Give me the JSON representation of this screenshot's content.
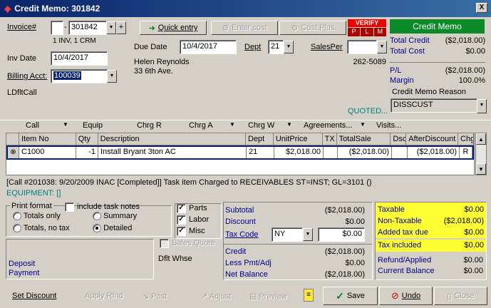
{
  "window": {
    "title": "Credit Memo: 301842",
    "close": "X"
  },
  "invoice": {
    "label": "Invoice#",
    "prefix": "",
    "number": "301842",
    "sub": "1 INV, 1 CRM"
  },
  "toolbar": {
    "quick_entry": "Quick entry",
    "enter_cost": "Enter cost",
    "cost_plus": "Cost Plus"
  },
  "verify": {
    "label": "VERIFY",
    "p": "P",
    "l": "L",
    "m": "M"
  },
  "memo_header": {
    "label": "Credit Memo"
  },
  "due": {
    "label": "Due Date",
    "value": "10/4/2017"
  },
  "dept": {
    "label": "Dept",
    "value": "21"
  },
  "salesper": {
    "label": "SalesPer",
    "value": ""
  },
  "inv_date": {
    "label": "Inv Date",
    "value": "10/4/2017"
  },
  "billing": {
    "label": "Billing Acct:",
    "value": "100039"
  },
  "customer": {
    "name": "Helen Reynolds",
    "address": "33 6th Ave.",
    "phone": "262-5089"
  },
  "ldflt": "LDfltCall",
  "totals_top": {
    "total_credit_label": "Total Credit",
    "total_credit": "($2,018.00)",
    "total_cost_label": "Total Cost",
    "total_cost": "$0.00",
    "pl_label": "P/L",
    "pl": "($2,018.00)",
    "margin_label": "Margin",
    "margin": "100.0%"
  },
  "reason": {
    "label": "Credit Memo Reason",
    "value": "DISSCUST"
  },
  "quoted": "QUOTED...",
  "menu": {
    "call": "Call",
    "equip": "Equip",
    "chrg_r": "Chrg R",
    "chrg_a": "Chrg A",
    "chrg_w": "Chrg W",
    "agreements": "Agreements...",
    "visits": "Visits..."
  },
  "table": {
    "headers": [
      "Item No",
      "Qty",
      "Description",
      "Dept",
      "UnitPrice",
      "TX",
      "TotalSale",
      "Dsc",
      "AfterDiscount",
      "Chg"
    ],
    "rows": [
      [
        "C1000",
        "-1",
        "Install Bryant 3ton AC",
        "21",
        "$2,018.00",
        "",
        "($2,018.00)",
        "",
        "($2,018.00)",
        "R"
      ]
    ]
  },
  "call_info": "[Call #201038: 9/20/2009 INAC [Completed]]  Task item Charged to RECEIVABLES ST=INST; GL=3101 ()",
  "equipment": "EQUIPMENT: []",
  "print": {
    "legend": "Print format",
    "include_notes": "include task notes",
    "totals_only": "Totals only",
    "summary": "Summary",
    "totals_no_tax": "Totals, no tax",
    "detailed": "Detailed"
  },
  "parts_checks": {
    "parts": "Parts",
    "labor": "Labor",
    "misc": "Misc",
    "sales_quote": "Sales Quote",
    "dflt_whse": "Dflt Whse"
  },
  "deposit": {
    "label1": "Deposit",
    "label2": "Payment"
  },
  "summary": {
    "subtotal_label": "Subtotal",
    "subtotal": "($2,018.00)",
    "discount_label": "Discount",
    "discount": "$0.00",
    "taxcode_label": "Tax Code",
    "taxcode": "NY",
    "taxcode_amount": "$0.00",
    "credit_label": "Credit",
    "credit": "($2,018.00)",
    "lesspmt_label": "Less Pmt/Adj",
    "lesspmt": "$0.00",
    "net_label": "Net Balance",
    "net": "($2,018.00)"
  },
  "tax": {
    "taxable_label": "Taxable",
    "taxable": "$0.00",
    "nontaxable_label": "Non-Taxable",
    "nontaxable": "($2,018.00)",
    "added_label": "Added tax due",
    "added": "$0.00",
    "included_label": "Tax included",
    "included": "$0.00",
    "refund_label": "Refund/Applied",
    "refund": "$0.00",
    "current_label": "Current Balance",
    "current": "$0.00"
  },
  "bottom": {
    "set_discount": "Set Discount",
    "apply_rfnd": "Apply Rfnd",
    "post": "Post",
    "adjust": "Adjust",
    "preview": "Preview",
    "save": "Save",
    "undo": "Undo",
    "close": "Close"
  }
}
